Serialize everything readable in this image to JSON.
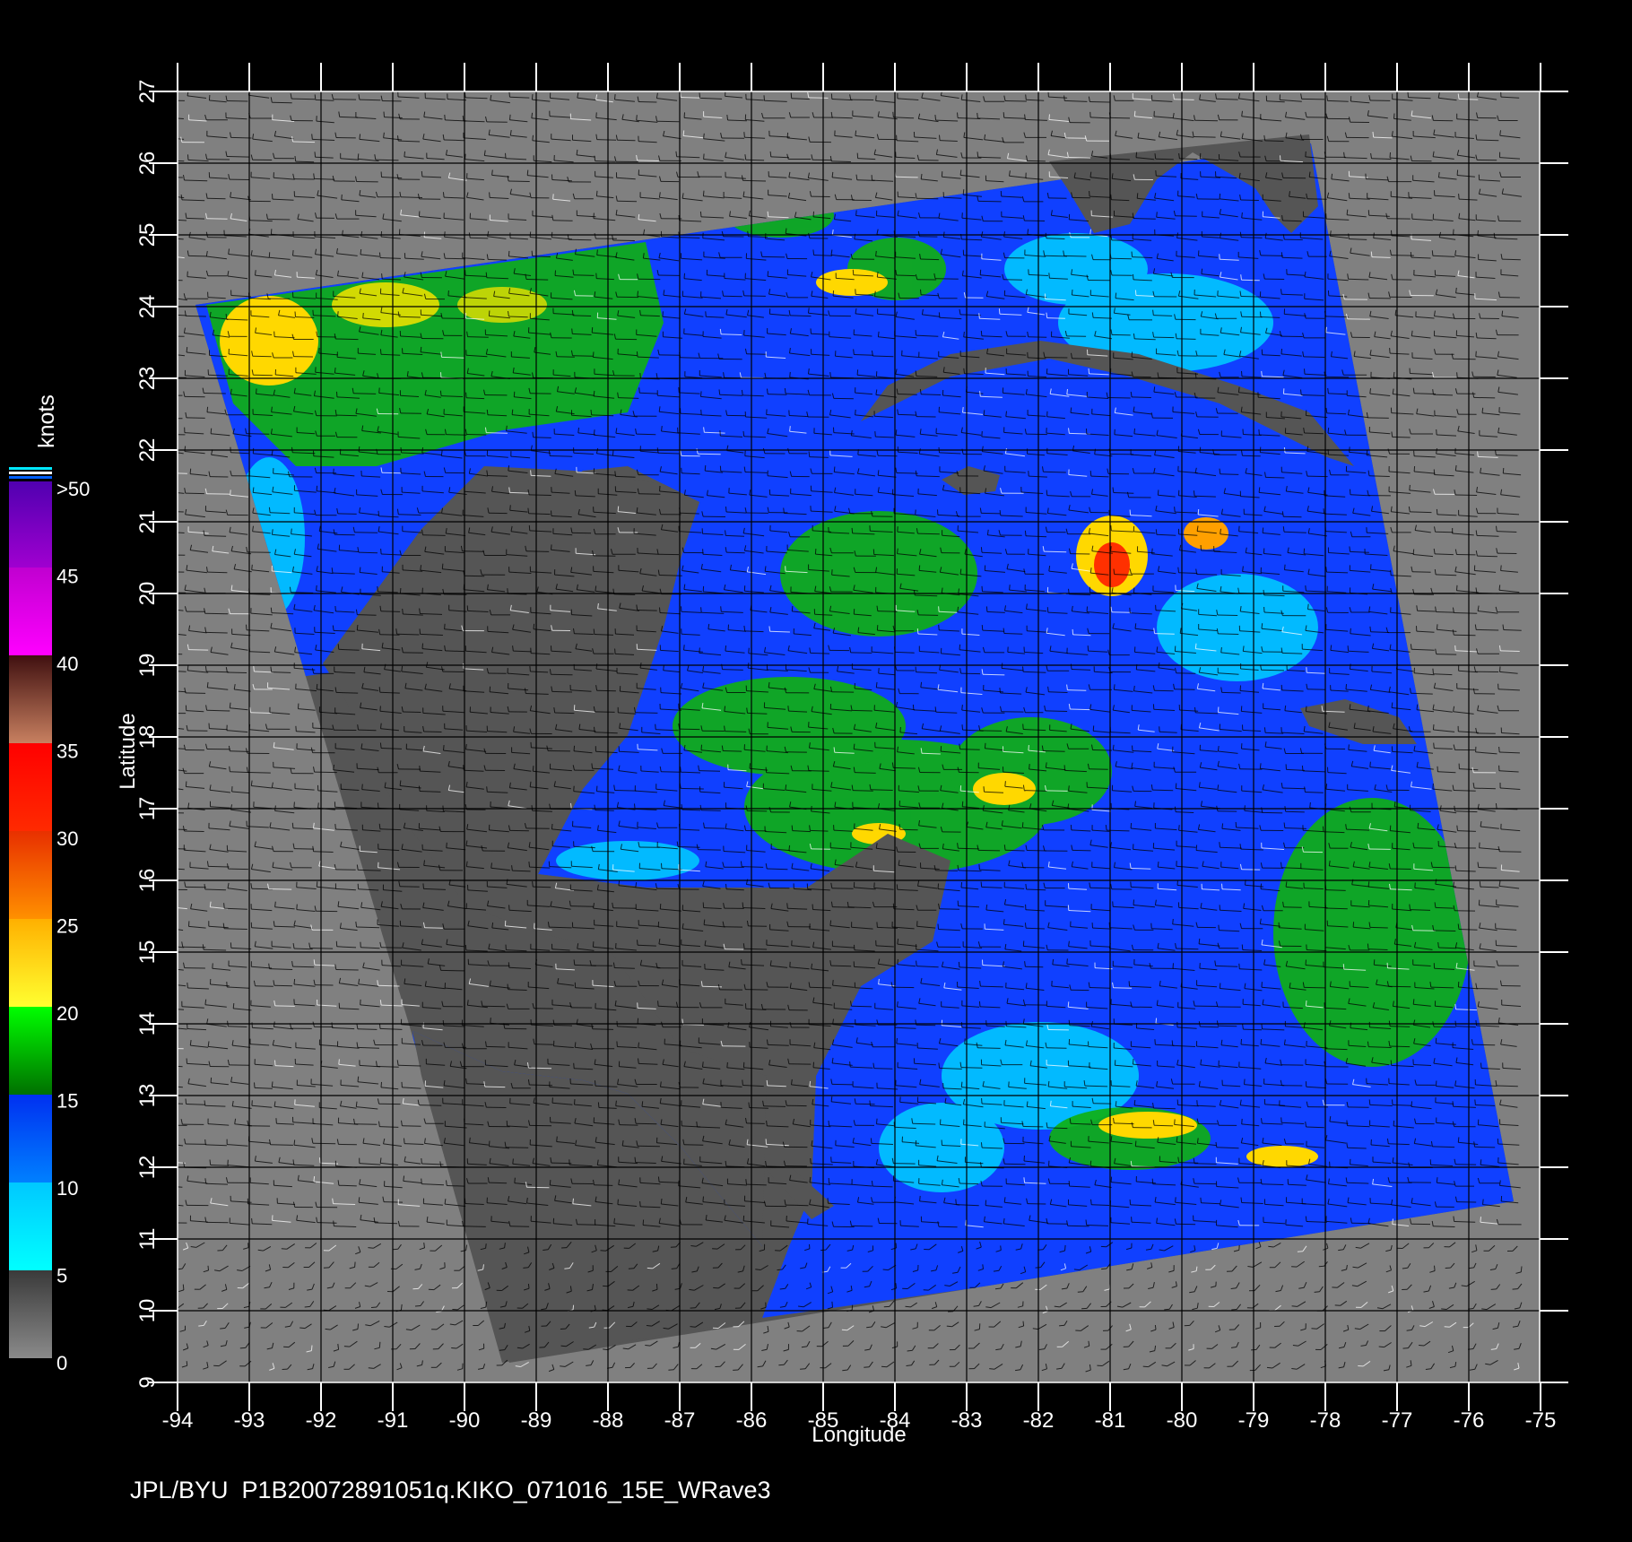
{
  "map": {
    "x_axis": {
      "label": "Longitude",
      "ticks": [
        "-94",
        "-93",
        "-92",
        "-91",
        "-90",
        "-89",
        "-88",
        "-87",
        "-86",
        "-85",
        "-84",
        "-83",
        "-82",
        "-81",
        "-80",
        "-79",
        "-78",
        "-77",
        "-76",
        "-75"
      ]
    },
    "y_axis": {
      "label": "Latitude",
      "ticks": [
        "9",
        "10",
        "11",
        "12",
        "13",
        "14",
        "15",
        "16",
        "17",
        "18",
        "19",
        "20",
        "21",
        "22",
        "23",
        "24",
        "25",
        "26",
        "27"
      ]
    },
    "footer": "JPL/BYU  P1B20072891051q.KIKO_071016_15E_WRave3",
    "colors": {
      "background": "#000000",
      "outside_swath": "#808080",
      "land": "#505050",
      "grid": "#000000"
    }
  },
  "colorbar": {
    "unit_label": "knots",
    "labels": [
      ">50",
      "45",
      "40",
      "35",
      "30",
      "25",
      "20",
      "15",
      "10",
      "5",
      "0"
    ],
    "bins": [
      {
        "from": 0,
        "to": 5,
        "color": "#7a7a7a"
      },
      {
        "from": 5,
        "to": 10,
        "color": "#00e8f0"
      },
      {
        "from": 10,
        "to": 15,
        "color": "#0060ff"
      },
      {
        "from": 15,
        "to": 20,
        "color": "#00b800"
      },
      {
        "from": 20,
        "to": 25,
        "color": "#ffd800"
      },
      {
        "from": 25,
        "to": 30,
        "color": "#ff8000"
      },
      {
        "from": 30,
        "to": 35,
        "color": "#ff2000"
      },
      {
        "from": 35,
        "to": 40,
        "color": "#a05040"
      },
      {
        "from": 40,
        "to": 45,
        "color": "#ff00ff"
      },
      {
        "from": 45,
        "to": 50,
        "color": "#9000d0"
      }
    ]
  }
}
